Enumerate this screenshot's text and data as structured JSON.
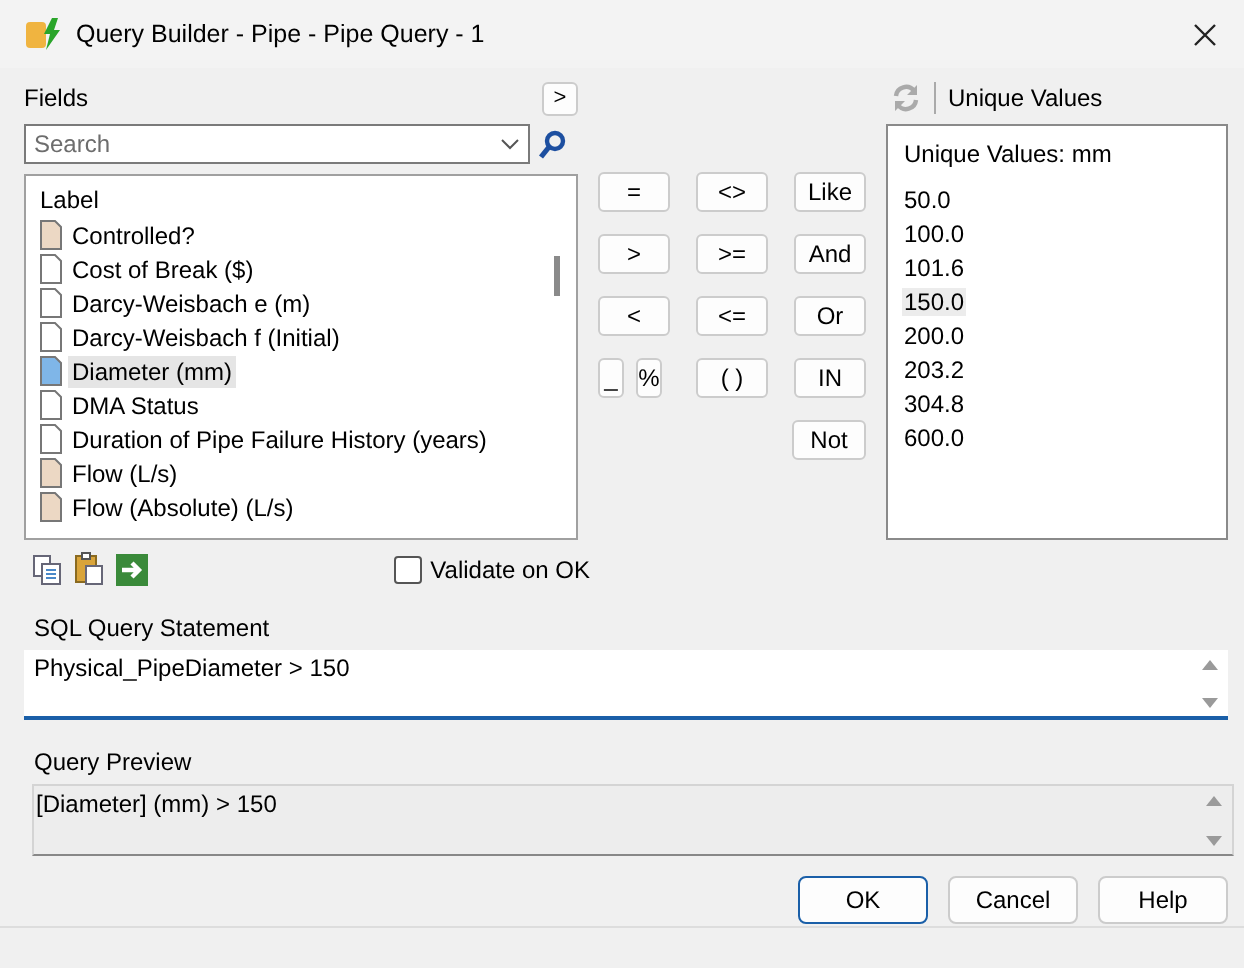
{
  "window": {
    "title": "Query Builder - Pipe - Pipe Query - 1"
  },
  "fields": {
    "label": "Fields",
    "expand_button": ">",
    "search": {
      "placeholder": "Search"
    },
    "column": "Label",
    "items": [
      {
        "label": "Controlled?",
        "kind": "result",
        "selected": false
      },
      {
        "label": "Cost of Break ($)",
        "kind": "plain",
        "selected": false
      },
      {
        "label": "Darcy-Weisbach e (m)",
        "kind": "plain",
        "selected": false
      },
      {
        "label": "Darcy-Weisbach f (Initial)",
        "kind": "plain",
        "selected": false
      },
      {
        "label": "Diameter (mm)",
        "kind": "physical",
        "selected": true
      },
      {
        "label": "DMA Status",
        "kind": "plain",
        "selected": false
      },
      {
        "label": "Duration of Pipe Failure History (years)",
        "kind": "plain",
        "selected": false
      },
      {
        "label": "Flow (L/s)",
        "kind": "result",
        "selected": false
      },
      {
        "label": "Flow (Absolute) (L/s)",
        "kind": "result",
        "selected": false
      }
    ]
  },
  "operators": [
    [
      "=",
      "<>",
      "Like"
    ],
    [
      ">",
      ">=",
      "And"
    ],
    [
      "<",
      "<=",
      "Or"
    ],
    [
      "_",
      "%",
      "( )",
      "IN"
    ],
    [
      "Not"
    ]
  ],
  "validate_on_ok": {
    "label": "Validate on OK",
    "checked": false
  },
  "unique_values": {
    "label": "Unique Values",
    "column": "Unique Values: mm",
    "items": [
      {
        "label": "50.0",
        "selected": false
      },
      {
        "label": "100.0",
        "selected": false
      },
      {
        "label": "101.6",
        "selected": false
      },
      {
        "label": "150.0",
        "selected": true
      },
      {
        "label": "200.0",
        "selected": false
      },
      {
        "label": "203.2",
        "selected": false
      },
      {
        "label": "304.8",
        "selected": false
      },
      {
        "label": "600.0",
        "selected": false
      }
    ]
  },
  "sql_statement": {
    "label": "SQL Query Statement",
    "value": "Physical_PipeDiameter > 150"
  },
  "query_preview": {
    "label": "Query Preview",
    "value": "[Diameter] (mm) > 150"
  },
  "buttons": [
    {
      "label": "OK",
      "default": true
    },
    {
      "label": "Cancel",
      "default": false
    },
    {
      "label": "Help",
      "default": false
    }
  ]
}
